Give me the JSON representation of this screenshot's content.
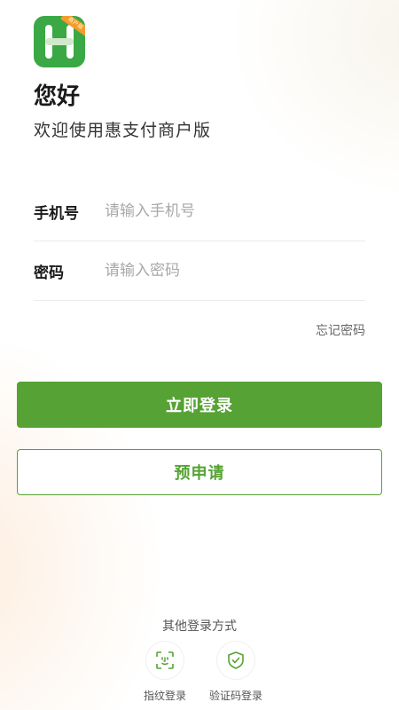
{
  "app": {
    "logo_letter": "H",
    "logo_badge": "商户版"
  },
  "header": {
    "greeting": "您好",
    "welcome": "欢迎使用惠支付商户版"
  },
  "form": {
    "phone": {
      "label": "手机号",
      "placeholder": "请输入手机号",
      "value": ""
    },
    "password": {
      "label": "密码",
      "placeholder": "请输入密码",
      "value": ""
    },
    "forgot_label": "忘记密码"
  },
  "actions": {
    "login_label": "立即登录",
    "apply_label": "预申请"
  },
  "other_login": {
    "title": "其他登录方式",
    "methods": [
      {
        "label": "指纹登录",
        "icon": "face-scan-icon"
      },
      {
        "label": "验证码登录",
        "icon": "shield-check-icon"
      }
    ]
  },
  "colors": {
    "primary": "#56a234",
    "logo": "#3aa845",
    "badge": "#f39c2c"
  }
}
